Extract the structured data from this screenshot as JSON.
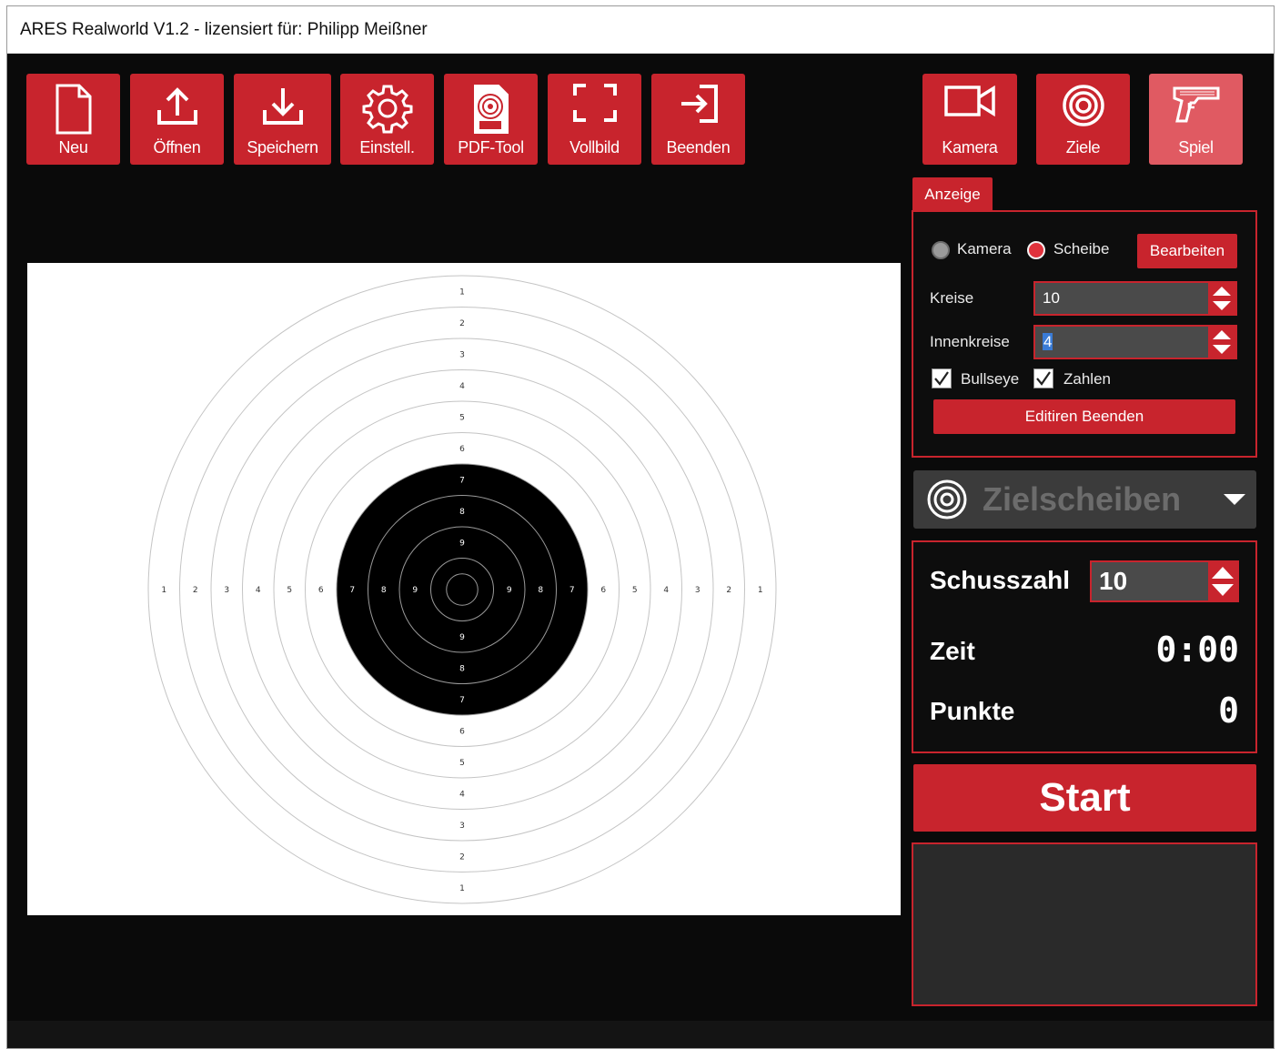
{
  "window": {
    "title": "ARES Realworld V1.2 - lizensiert für: Philipp Meißner"
  },
  "toolbar": {
    "neu": "Neu",
    "oeffnen": "Öffnen",
    "speichern": "Speichern",
    "einstell": "Einstell.",
    "pdf_tool": "PDF-Tool",
    "vollbild": "Vollbild",
    "beenden": "Beenden"
  },
  "mode_buttons": {
    "kamera": "Kamera",
    "ziele": "Ziele",
    "spiel": "Spiel",
    "active": "spiel"
  },
  "anzeige": {
    "tab_label": "Anzeige",
    "radio_kamera": "Kamera",
    "radio_scheibe": "Scheibe",
    "selected_radio": "scheibe",
    "bearbeiten_label": "Bearbeiten",
    "kreise_label": "Kreise",
    "kreise_value": "10",
    "innenkreise_label": "Innenkreise",
    "innenkreise_value": "4",
    "bullseye_label": "Bullseye",
    "bullseye_checked": true,
    "zahlen_label": "Zahlen",
    "zahlen_checked": true,
    "editiren_label": "Editiren Beenden"
  },
  "target_dropdown": {
    "selected": "Zielscheiben"
  },
  "score": {
    "schusszahl_label": "Schusszahl",
    "schusszahl_value": "10",
    "zeit_label": "Zeit",
    "zeit_value": "0:00",
    "punkte_label": "Punkte",
    "punkte_value": "0"
  },
  "start_label": "Start",
  "target": {
    "ring_count": 10,
    "inner_ring_count": 4,
    "black_from_ring": 7,
    "ring_numbers": [
      "1",
      "2",
      "3",
      "4",
      "5",
      "6",
      "7",
      "8",
      "9"
    ]
  },
  "colors": {
    "accent": "#c8242d",
    "accent_active": "#e05a62",
    "background": "#0a0a0a",
    "panel_input": "#4a4a4a"
  }
}
